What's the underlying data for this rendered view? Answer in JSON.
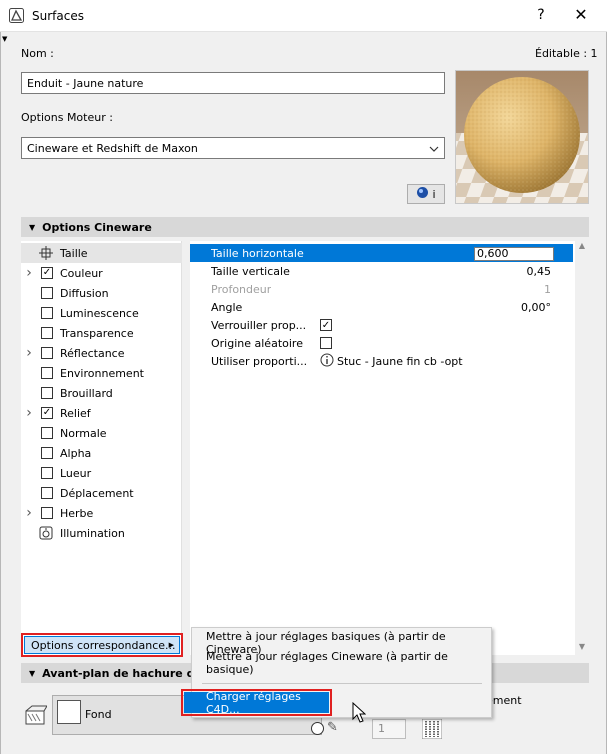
{
  "window": {
    "title": "Surfaces",
    "help": "?",
    "close": "✕"
  },
  "top": {
    "nom_label": "Nom :",
    "editable_label": "Éditable : 1",
    "nom_value": "Enduit - Jaune nature",
    "moteur_label": "Options Moteur :",
    "moteur_value": "Cineware et Redshift de Maxon",
    "info_btn": "i"
  },
  "sections": {
    "cineware": "Options Cineware",
    "avant_plan": "Avant-plan de hachure de r"
  },
  "left_list": [
    {
      "label": "Taille",
      "expandable": false,
      "checked": null,
      "icon": "size-icon",
      "selected": true
    },
    {
      "label": "Couleur",
      "expandable": true,
      "checked": true
    },
    {
      "label": "Diffusion",
      "expandable": false,
      "checked": false
    },
    {
      "label": "Luminescence",
      "expandable": false,
      "checked": false
    },
    {
      "label": "Transparence",
      "expandable": false,
      "checked": false
    },
    {
      "label": "Réflectance",
      "expandable": true,
      "checked": false
    },
    {
      "label": "Environnement",
      "expandable": false,
      "checked": false
    },
    {
      "label": "Brouillard",
      "expandable": false,
      "checked": false
    },
    {
      "label": "Relief",
      "expandable": true,
      "checked": true
    },
    {
      "label": "Normale",
      "expandable": false,
      "checked": false
    },
    {
      "label": "Alpha",
      "expandable": false,
      "checked": false
    },
    {
      "label": "Lueur",
      "expandable": false,
      "checked": false
    },
    {
      "label": "Déplacement",
      "expandable": false,
      "checked": false
    },
    {
      "label": "Herbe",
      "expandable": true,
      "checked": false
    },
    {
      "label": "Illumination",
      "expandable": false,
      "checked": null,
      "icon": "illumination-icon"
    }
  ],
  "properties": [
    {
      "label": "Taille horizontale",
      "value": "0,600",
      "selected": true
    },
    {
      "label": "Taille verticale",
      "value": "0,45"
    },
    {
      "label": "Profondeur",
      "value": "1",
      "disabled": true
    },
    {
      "label": "Angle",
      "value": "0,00°"
    },
    {
      "label": "Verrouiller prop...",
      "checkbox": true
    },
    {
      "label": "Origine aléatoire",
      "checkbox": false
    },
    {
      "label": "Utiliser proporti...",
      "value": "Stuc - Jaune fin cb -opt"
    }
  ],
  "bottom": {
    "options_btn": "Options correspondance...",
    "fond_label": "Fond",
    "ement_label": "ement",
    "num_value": "1"
  },
  "menu": {
    "item1": "Mettre à jour réglages basiques (à partir de Cineware)",
    "item2": "Mettre à jour réglages Cineware (à partir de basique)",
    "item3": "Charger réglages C4D..."
  }
}
